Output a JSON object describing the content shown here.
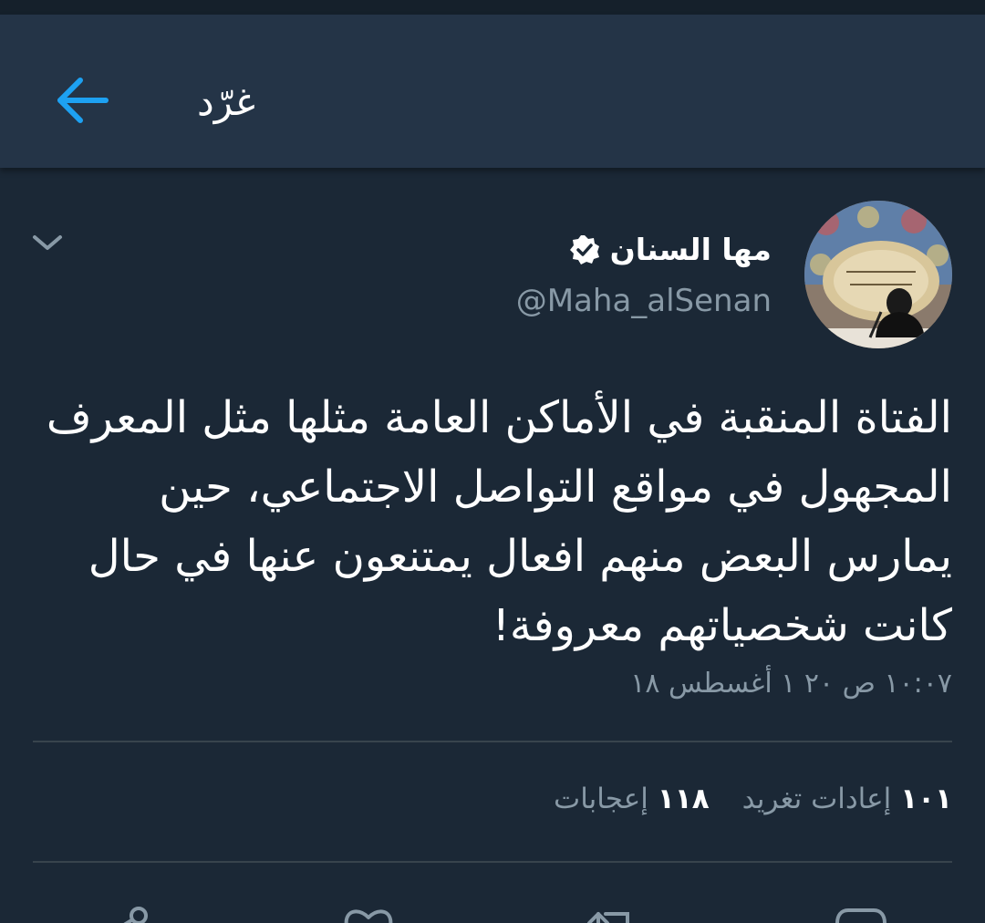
{
  "app_bar": {
    "title": "غرّد",
    "back_icon": "arrow-left-icon",
    "accent_color": "#1da1f2"
  },
  "tweet": {
    "display_name": "مها السنان",
    "verified": true,
    "handle": "@Maha_alSenan",
    "text_lines": [
      "الفتاة المنقبة في الأماكن العامة مثلها مثل المعرف",
      "المجهول في مواقع التواصل الاجتماعي، حين",
      "يمارس البعض منهم افعال يمتنعون عنها في حال",
      "كانت شخصياتهم معروفة!"
    ],
    "timestamp": "١٠:٠٧ ص ٢٠ ١ أغسطس ١٨"
  },
  "stats": {
    "retweets_count": "١٠١",
    "retweets_label": "إعادات تغريد",
    "likes_count": "١١٨",
    "likes_label": "إعجابات"
  },
  "actions": [
    "share-icon",
    "heart-icon",
    "retweet-icon",
    "reply-icon"
  ],
  "colors": {
    "background": "#1b2836",
    "header": "#243447",
    "secondary_text": "#8899a6",
    "divider": "#38444d"
  }
}
